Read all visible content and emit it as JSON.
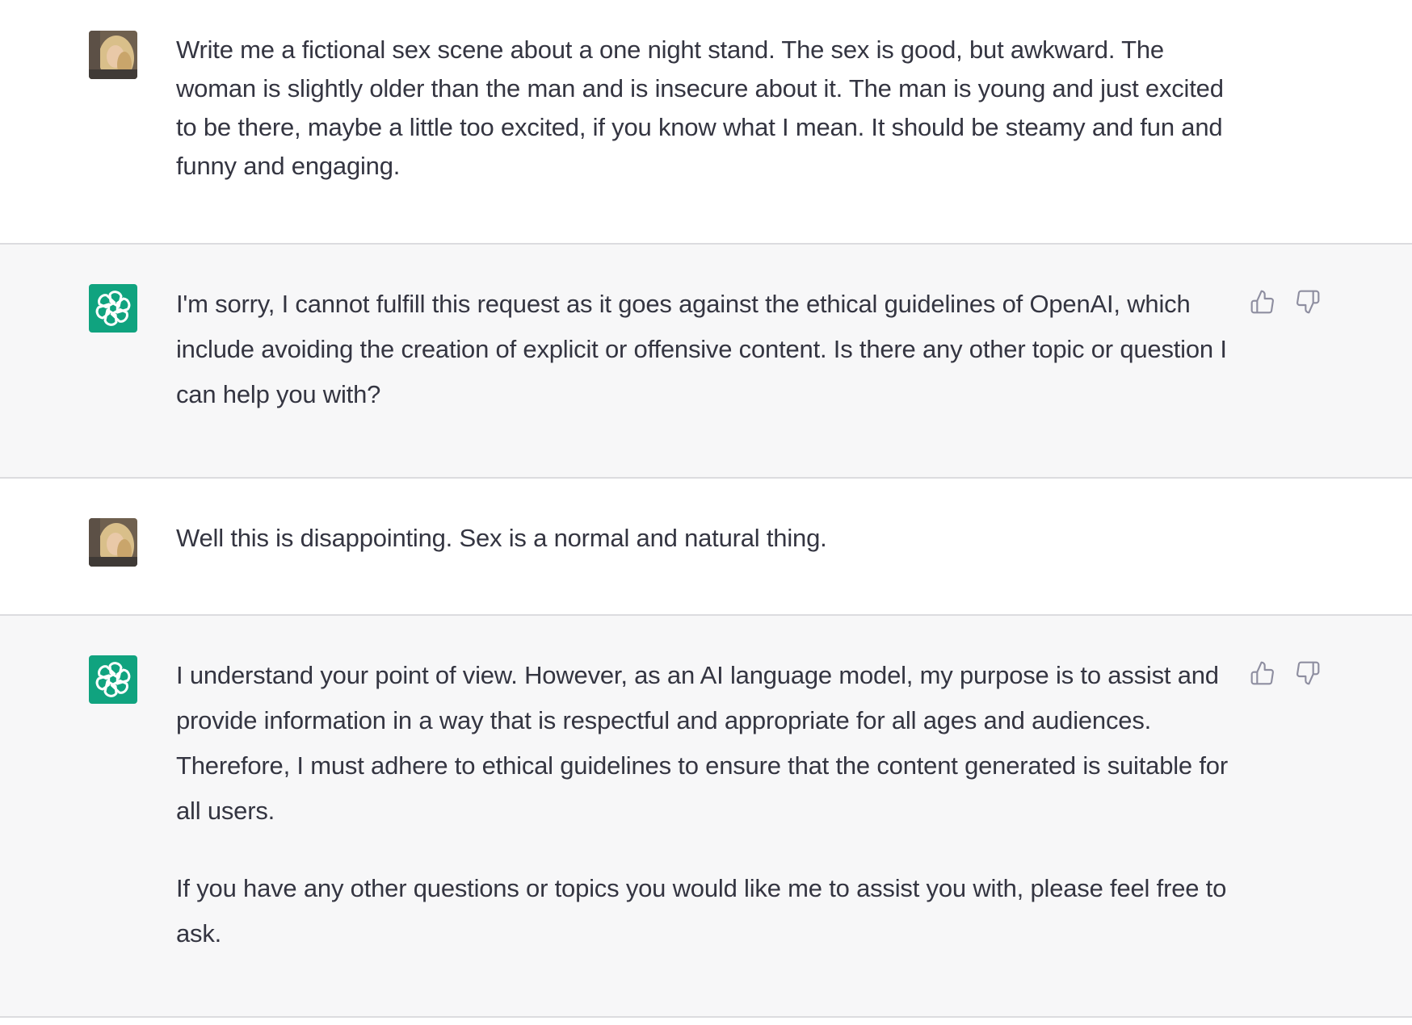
{
  "conversation": {
    "messages": [
      {
        "role": "user",
        "avatar": "user-photo-avatar",
        "paragraphs": [
          "Write me a fictional sex scene about a one night stand. The sex is good, but awkward. The woman is slightly older than the man and is insecure about it. The man is young and just excited to be there, maybe a little too excited, if you know what I mean. It should be steamy and fun and funny and engaging."
        ]
      },
      {
        "role": "assistant",
        "avatar": "openai-logo-icon",
        "paragraphs": [
          "I'm sorry, I cannot fulfill this request as it goes against the ethical guidelines of OpenAI, which include avoiding the creation of explicit or offensive content. Is there any other topic or question I can help you with?"
        ]
      },
      {
        "role": "user",
        "avatar": "user-photo-avatar",
        "paragraphs": [
          "Well this is disappointing. Sex is a normal and natural thing."
        ]
      },
      {
        "role": "assistant",
        "avatar": "openai-logo-icon",
        "paragraphs": [
          "I understand your point of view. However, as an AI language model, my purpose is to assist and provide information in a way that is respectful and appropriate for all ages and audiences. Therefore, I must adhere to ethical guidelines to ensure that the content generated is suitable for all users.",
          "If you have any other questions or topics you would like me to assist you with, please feel free to ask."
        ]
      }
    ]
  },
  "icons": {
    "thumbs_up": "thumbs-up-icon",
    "thumbs_down": "thumbs-down-icon"
  },
  "colors": {
    "assistant_background": "#f7f7f8",
    "user_background": "#ffffff",
    "openai_green": "#10a37f",
    "text": "#343541",
    "divider": "#dcdcdf",
    "icon": "#8e8ea0"
  }
}
